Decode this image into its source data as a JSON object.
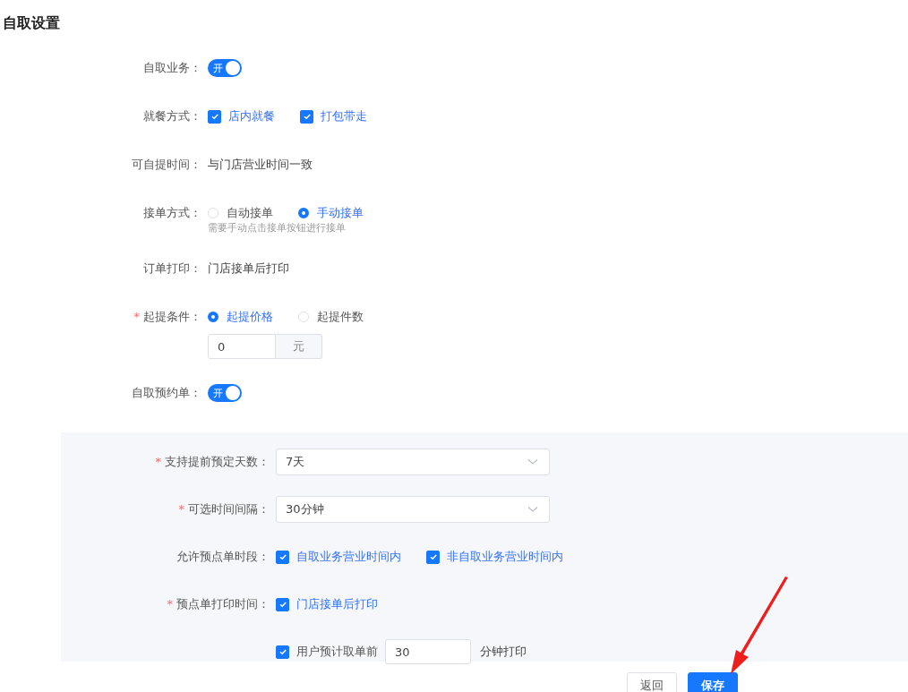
{
  "title": "自取设置",
  "rows": [
    {
      "kind": "switch",
      "label": "自取业务：",
      "on": true,
      "switch_text": "开"
    },
    {
      "kind": "checkbox",
      "label": "就餐方式：",
      "options": [
        {
          "label": "店内就餐",
          "checked": true
        },
        {
          "label": "打包带走",
          "checked": true
        }
      ]
    },
    {
      "kind": "text",
      "label": "可自提时间：",
      "value": "与门店营业时间一致"
    },
    {
      "kind": "radio",
      "label": "接单方式：",
      "options": [
        {
          "label": "自动接单",
          "selected": false
        },
        {
          "label": "手动接单",
          "selected": true
        }
      ],
      "help": "需要手动点击接单按钮进行接单"
    },
    {
      "kind": "text",
      "label": "订单打印：",
      "value": "门店接单后打印"
    },
    {
      "kind": "radio",
      "label": "起提条件：",
      "mark": "*",
      "options": [
        {
          "label": "起提价格",
          "selected": true
        },
        {
          "label": "起提件数",
          "selected": false
        }
      ],
      "input": {
        "value": "0",
        "suffix": "元"
      }
    },
    {
      "kind": "switch",
      "label": "自取预约单：",
      "on": true,
      "switch_text": "开"
    }
  ],
  "reservation": [
    {
      "kind": "select",
      "label": "支持提前预定天数：",
      "mark": "*",
      "value": "7天"
    },
    {
      "kind": "select",
      "label": "可选时间间隔：",
      "mark": "*",
      "value": "30分钟"
    },
    {
      "kind": "checkbox",
      "label": "允许预点单时段：",
      "options": [
        {
          "label": "自取业务营业时间内",
          "checked": true
        },
        {
          "label": "非自取业务营业时间内",
          "checked": true
        }
      ]
    },
    {
      "kind": "checkbox",
      "label": "预点单打印时间：",
      "mark": "*",
      "options": [
        {
          "label": "门店接单后打印",
          "checked": true
        }
      ]
    },
    {
      "kind": "checkbox-input",
      "checked": true,
      "before": "用户预计取单前",
      "value": "30",
      "after": "分钟打印"
    }
  ],
  "buttons": [
    {
      "label": "返回",
      "kind": "default"
    },
    {
      "label": "保存",
      "kind": "primary"
    }
  ]
}
